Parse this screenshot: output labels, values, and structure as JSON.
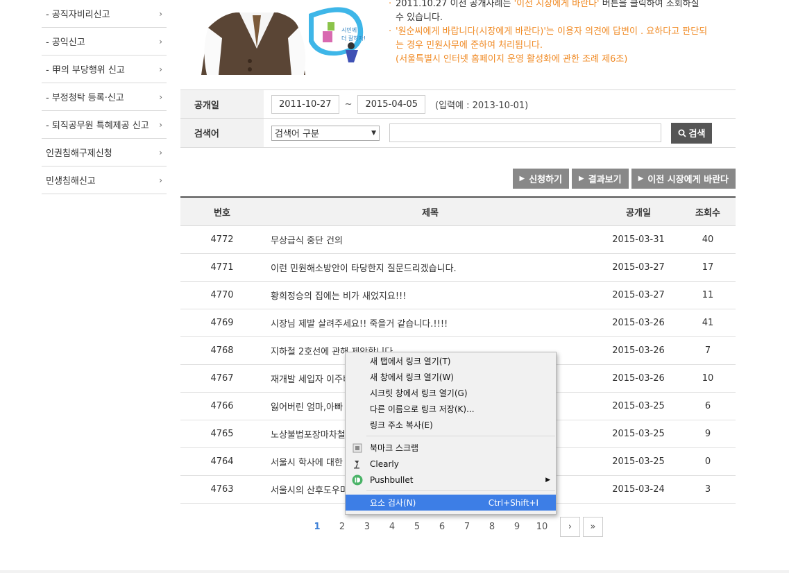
{
  "sidebar": {
    "items": [
      {
        "label": "- 공직자비리신고"
      },
      {
        "label": "- 공익신고"
      },
      {
        "label": "- 甲의 부당행위 신고"
      },
      {
        "label": "- 부정청탁 등록·신고"
      },
      {
        "label": "- 퇴직공무원 특혜제공 신고"
      },
      {
        "label": "인권침해구제신청"
      },
      {
        "label": "민생침해신고"
      }
    ]
  },
  "banner": {
    "bubble_text": "시민께 더 잘하자!",
    "line1_prefix": "2011.10.27 이전 공개사례는 ",
    "line1_highlight": "'이전 시장에게 바란다'",
    "line1_suffix": " 버튼을 클릭하여 조회하실 수 있습니다.",
    "line2": "'원순씨에게 바랍니다(시장에게 바란다)'는 이용자 의견에 답변이 . 요하다고 판단되는 경우 민원사무에 준하여 처리됩니다.",
    "line3": "(서울특별시 인터넷 홈페이지 운영 활성화에 관한 조례 제6조)"
  },
  "search": {
    "date_label": "공개일",
    "date_from": "2011-10-27",
    "tilde": "~",
    "date_to": "2015-04-05",
    "example": "(입력예 : 2013-10-01)",
    "keyword_label": "검색어",
    "select_value": "검색어 구분",
    "button_label": "검색"
  },
  "actions": {
    "apply": "신청하기",
    "results": "결과보기",
    "previous": "이전 시장에게 바란다"
  },
  "table": {
    "headers": {
      "no": "번호",
      "title": "제목",
      "date": "공개일",
      "views": "조회수"
    },
    "rows": [
      {
        "no": "4772",
        "title": "무상급식 중단 건의",
        "date": "2015-03-31",
        "views": "40"
      },
      {
        "no": "4771",
        "title": "이런 민원해소방안이 타당한지 질문드리겠습니다.",
        "date": "2015-03-27",
        "views": "17"
      },
      {
        "no": "4770",
        "title": "황희정승의 집에는 비가 새었지요!!!",
        "date": "2015-03-27",
        "views": "11"
      },
      {
        "no": "4769",
        "title": "시장님 제발 살려주세요!! 죽을거 같습니다.!!!!",
        "date": "2015-03-26",
        "views": "41"
      },
      {
        "no": "4768",
        "title": "지하철 2호선에 관해 제안합니다",
        "date": "2015-03-26",
        "views": "7"
      },
      {
        "no": "4767",
        "title": "재개발 세입자 이주비",
        "date": "2015-03-26",
        "views": "10"
      },
      {
        "no": "4766",
        "title": "잃어버린 엄마,아빠",
        "date": "2015-03-25",
        "views": "6"
      },
      {
        "no": "4765",
        "title": "노상불법포장마차철",
        "date": "2015-03-25",
        "views": "9"
      },
      {
        "no": "4764",
        "title": "서울시 학사에 대한",
        "date": "2015-03-25",
        "views": "0"
      },
      {
        "no": "4763",
        "title": "서울시의 산후도우미",
        "date": "2015-03-24",
        "views": "3"
      }
    ]
  },
  "pagination": {
    "pages": [
      "1",
      "2",
      "3",
      "4",
      "5",
      "6",
      "7",
      "8",
      "9",
      "10"
    ],
    "next": "›",
    "last": "»"
  },
  "context_menu": {
    "open_tab": "새 탭에서 링크 열기(T)",
    "open_window": "새 창에서 링크 열기(W)",
    "open_incognito": "시크릿 창에서 링크 열기(G)",
    "save_link": "다른 이름으로 링크 저장(K)...",
    "copy_link": "링크 주소 복사(E)",
    "bookmark_scrap": "북마크 스크랩",
    "clearly": "Clearly",
    "pushbullet": "Pushbullet",
    "inspect": "요소 검사(N)",
    "inspect_shortcut": "Ctrl+Shift+I"
  },
  "colors": {
    "accent_orange": "#f08a24",
    "active_page": "#3b7fd6",
    "menu_highlight": "#3d7ee6",
    "button_gray": "#888888"
  }
}
